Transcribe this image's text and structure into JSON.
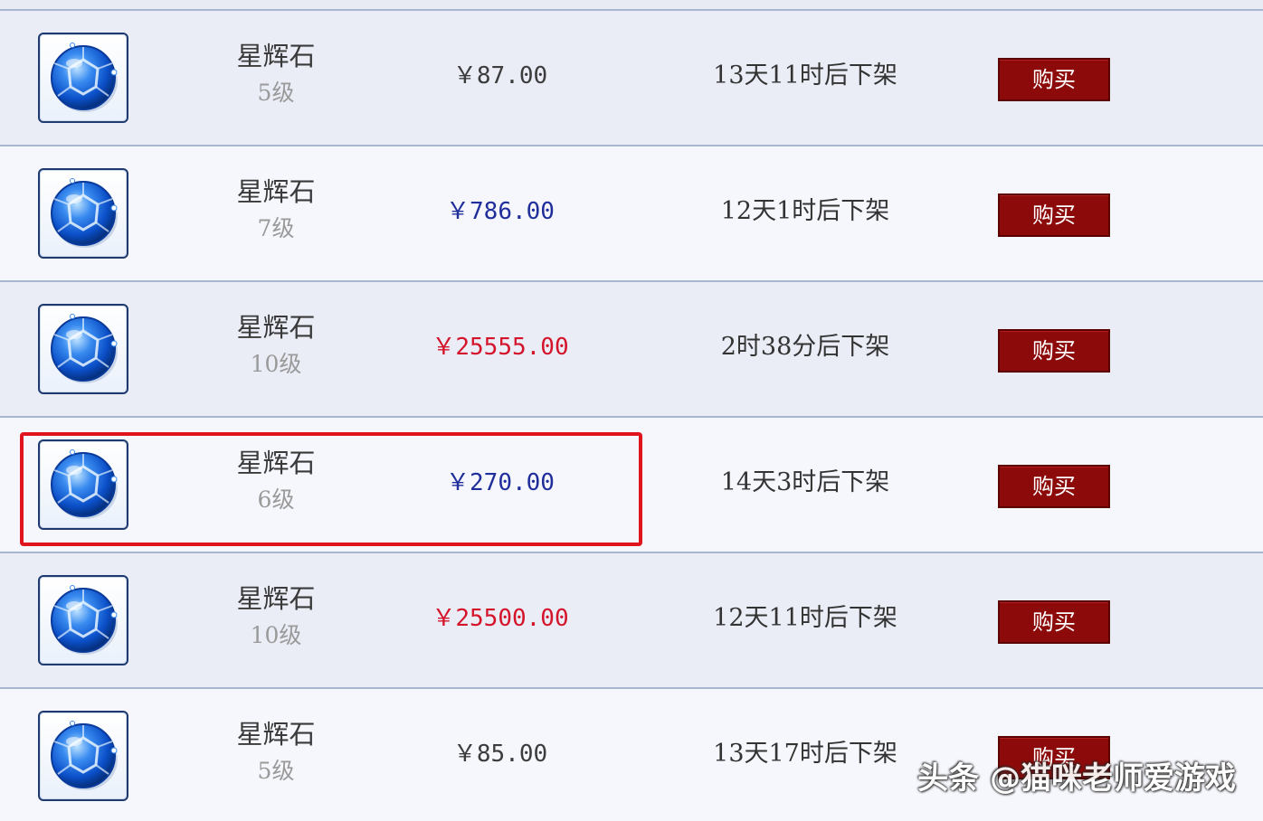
{
  "listings": [
    {
      "name": "星辉石",
      "level": "5级",
      "price": "￥87.00",
      "price_tier": "low",
      "time_left": "13天11时后下架",
      "buy_label": "购买",
      "icon": "blue-gem-icon"
    },
    {
      "name": "星辉石",
      "level": "7级",
      "price": "￥786.00",
      "price_tier": "mid",
      "time_left": "12天1时后下架",
      "buy_label": "购买",
      "icon": "blue-gem-icon"
    },
    {
      "name": "星辉石",
      "level": "10级",
      "price": "￥25555.00",
      "price_tier": "high",
      "time_left": "2时38分后下架",
      "buy_label": "购买",
      "icon": "blue-gem-icon"
    },
    {
      "name": "星辉石",
      "level": "6级",
      "price": "￥270.00",
      "price_tier": "mid",
      "time_left": "14天3时后下架",
      "buy_label": "购买",
      "icon": "blue-gem-icon",
      "highlighted": true
    },
    {
      "name": "星辉石",
      "level": "10级",
      "price": "￥25500.00",
      "price_tier": "high",
      "time_left": "12天11时后下架",
      "buy_label": "购买",
      "icon": "blue-gem-icon"
    },
    {
      "name": "星辉石",
      "level": "5级",
      "price": "￥85.00",
      "price_tier": "low",
      "time_left": "13天17时后下架",
      "buy_label": "购买",
      "icon": "blue-gem-icon"
    }
  ],
  "colors": {
    "price_low": "#3c3c3c",
    "price_mid": "#1f2e9a",
    "price_high": "#d4142a",
    "buy_button": "#8c0a0a",
    "highlight_border": "#e0141c",
    "row_border": "#a9b6d2"
  },
  "watermark": "头条 @猫咪老师爱游戏"
}
